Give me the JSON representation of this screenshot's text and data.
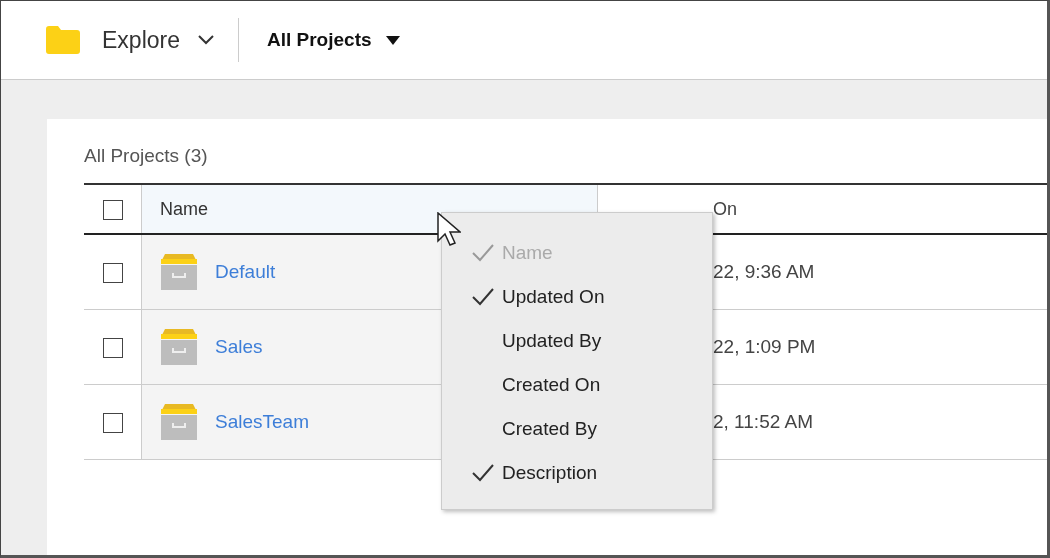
{
  "header": {
    "app_menu": "Explore",
    "project_menu": "All Projects"
  },
  "list_title": "All Projects (3)",
  "table": {
    "select_all": {
      "checked": false
    },
    "columns": [
      "Name",
      "On"
    ],
    "rows": [
      {
        "checked": false,
        "name": "Default",
        "updated": "22, 9:36 AM"
      },
      {
        "checked": false,
        "name": "Sales",
        "updated": "22, 1:09 PM"
      },
      {
        "checked": false,
        "name": "SalesTeam",
        "updated": "2, 11:52 AM"
      }
    ]
  },
  "column_menu": [
    {
      "label": "Name",
      "checked": true,
      "disabled": true
    },
    {
      "label": "Updated On",
      "checked": true,
      "disabled": false
    },
    {
      "label": "Updated By",
      "checked": false,
      "disabled": false
    },
    {
      "label": "Created On",
      "checked": false,
      "disabled": false
    },
    {
      "label": "Created By",
      "checked": false,
      "disabled": false
    },
    {
      "label": "Description",
      "checked": true,
      "disabled": false
    }
  ]
}
